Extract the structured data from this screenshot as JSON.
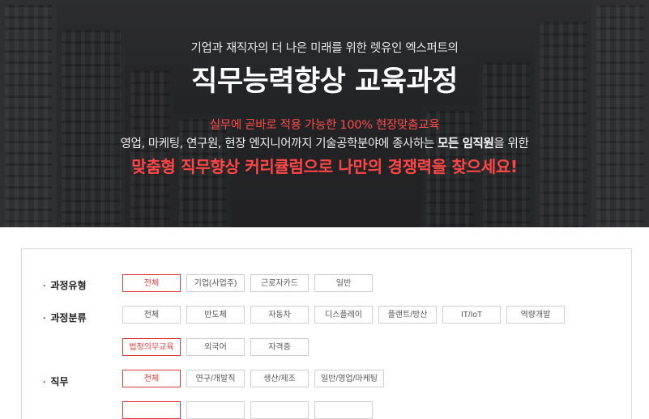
{
  "hero": {
    "subtitle": "기업과 재직자의 더 나은 미래를 위한 렛유인 엑스퍼트의",
    "title": "직무능력향상 교육과정",
    "tagline_red": "실무에 곧바로 적용 가능한 100% 현장맞춤교육",
    "desc_pre": "영업, 마케팅, 연구원, 현장 엔지니어까지 기술공학분야에 종사하는 ",
    "desc_bold": "모든 임직원",
    "desc_post": "을 위한",
    "cta_red": "맞춤형 직무향상 커리큘럼으로 나만의 경쟁력을 찾으세요!"
  },
  "filters": {
    "course_type": {
      "label": "과정유형",
      "options": [
        "전체",
        "기업(사업주)",
        "근로자카드",
        "일반"
      ],
      "selected": "전체"
    },
    "course_category": {
      "label": "과정분류",
      "options": [
        "전체",
        "반도체",
        "자동차",
        "디스플레이",
        "플랜트/방산",
        "IT/IoT",
        "역량개발",
        "법정의무교육",
        "외국어",
        "자격증"
      ],
      "selected": "법정의무교육"
    },
    "job": {
      "label": "직무",
      "options": [
        "전체",
        "연구/개발직",
        "생산/제조",
        "일반/영업/마케팅"
      ],
      "selected": "전체"
    }
  },
  "colors": {
    "accent": "#e53a3a",
    "border": "#cfcfcf"
  }
}
